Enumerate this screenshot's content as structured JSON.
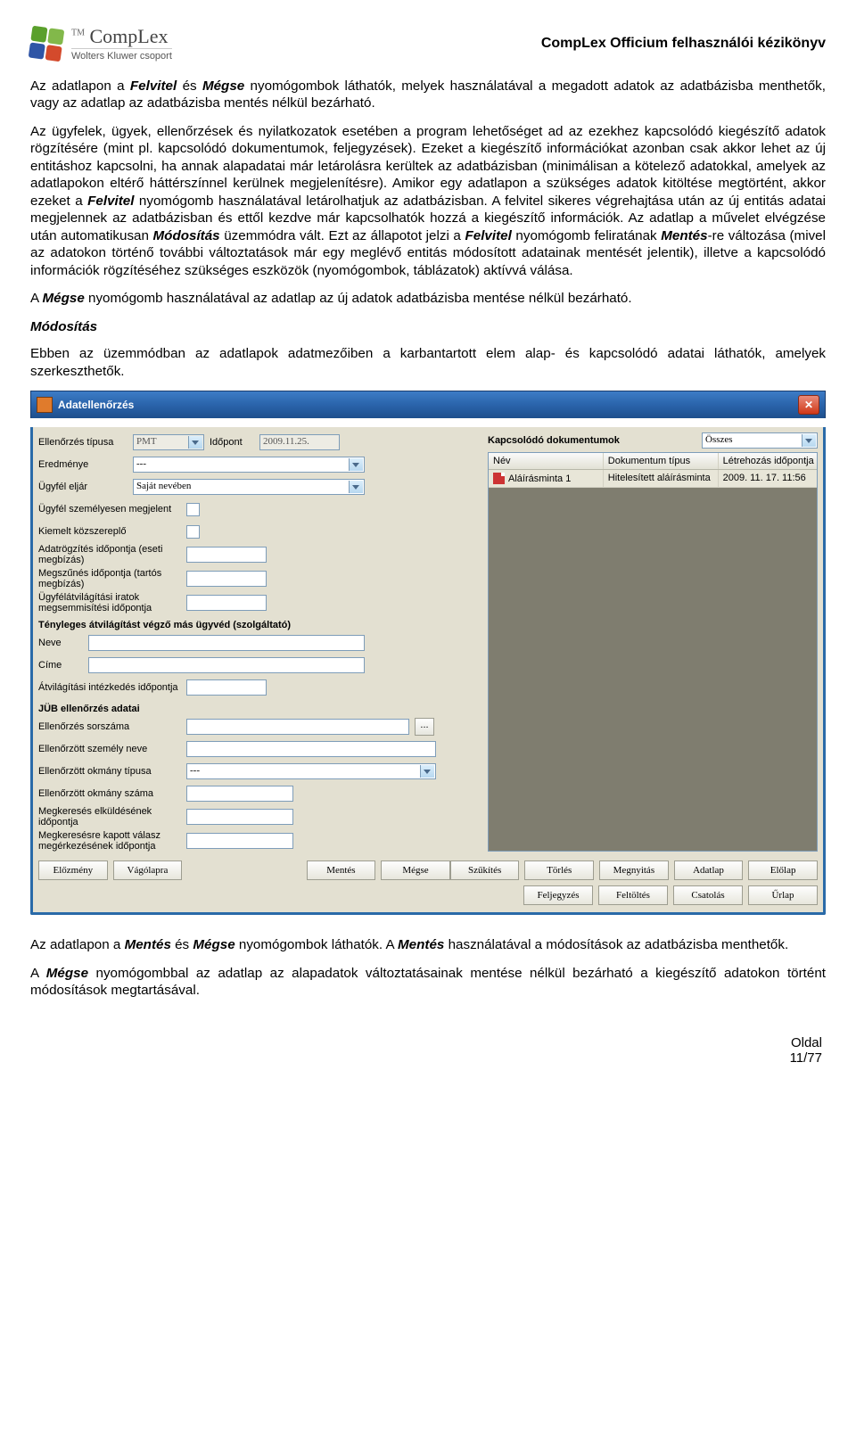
{
  "header": {
    "brand": "CompLex",
    "brand_prefix": "TM",
    "brand_sub": "Wolters Kluwer csoport",
    "doc_title": "CompLex Officium felhasználói kézikönyv"
  },
  "text": {
    "p1_a": "Az adatlapon a ",
    "p1_b": "Felvitel",
    "p1_c": " és ",
    "p1_d": "Mégse",
    "p1_e": " nyomógombok láthatók, melyek használatával a megadott adatok az adatbázisba menthetők, vagy az adatlap az adatbázisba mentés nélkül bezárható.",
    "p2_a": "Az ügyfelek, ügyek, ellenőrzések és nyilatkozatok esetében a program lehetőséget ad az ezekhez kapcsolódó kiegészítő adatok rögzítésére (mint pl. kapcsolódó dokumentumok, feljegyzések). Ezeket a kiegészítő információkat azonban csak akkor lehet az új entitáshoz kapcsolni, ha annak alapadatai már letárolásra kerültek az adatbázisban (minimálisan a kötelező adatokkal, amelyek az adatlapokon eltérő háttérszínnel kerülnek megjelenítésre). Amikor egy adatlapon a szükséges adatok kitöltése megtörtént, akkor ezeket a ",
    "p2_b": "Felvitel",
    "p2_c": " nyomógomb használatával letárolhatjuk az adatbázisban. A felvitel sikeres végrehajtása után az új entitás adatai megjelennek az adatbázisban és ettől kezdve már kapcsolhatók hozzá a kiegészítő információk. Az adatlap a művelet elvégzése után automatikusan ",
    "p2_d": "Módosítás",
    "p2_e": " üzemmódra vált. Ezt az állapotot jelzi a ",
    "p2_f": "Felvitel",
    "p2_g": " nyomógomb feliratának ",
    "p2_h": "Mentés",
    "p2_i": "-re változása (mivel az adatokon történő további változtatások már egy meglévő entitás módosított adatainak mentését jelentik), illetve a kapcsolódó információk rögzítéséhez szükséges eszközök (nyomógombok, táblázatok) aktívvá válása.",
    "p3_a": "A ",
    "p3_b": "Mégse",
    "p3_c": " nyomógomb használatával az adatlap az új adatok adatbázisba mentése nélkül bezárható.",
    "h_mod": "Módosítás",
    "p4": "Ebben az üzemmódban az adatlapok adatmezőiben a karbantartott elem alap- és kapcsolódó adatai láthatók, amelyek szerkeszthetők.",
    "p5_a": "Az adatlapon a ",
    "p5_b": "Mentés",
    "p5_c": " és ",
    "p5_d": "Mégse",
    "p5_e": " nyomógombok láthatók. A ",
    "p5_f": "Mentés",
    "p5_g": " használatával a módosítások az adatbázisba menthetők.",
    "p6_a": "A ",
    "p6_b": "Mégse",
    "p6_c": " nyomógombbal az adatlap az alapadatok változtatásainak mentése nélkül bezárható a kiegészítő adatokon történt módosítások megtartásával."
  },
  "dialog": {
    "title": "Adatellenőrzés",
    "labels": {
      "ell_tipus": "Ellenőrzés típusa",
      "idopont": "Időpont",
      "eredmenye": "Eredménye",
      "ugyfel_eljar": "Ügyfél eljár",
      "szemelyesen": "Ügyfél személyesen megjelent",
      "kiemelt": "Kiemelt közszereplő",
      "adatrogz": "Adatrögzítés időpontja (eseti megbízás)",
      "megszunes": "Megszűnés időpontja (tartós megbízás)",
      "megsemm": "Ügyfélátvilágítási iratok megsemmisítési időpontja",
      "section_tenyleges": "Tényleges átvilágítást végző más ügyvéd (szolgáltató)",
      "neve": "Neve",
      "cime": "Címe",
      "atvil_intez": "Átvilágítási intézkedés időpontja",
      "section_jub": "JÜB ellenőrzés adatai",
      "ell_sorszam": "Ellenőrzés sorszáma",
      "ell_szemely": "Ellenőrzött személy neve",
      "ell_okmany_t": "Ellenőrzött okmány típusa",
      "ell_okmany_sz": "Ellenőrzött okmány száma",
      "megkeres_elk": "Megkeresés elküldésének időpontja",
      "megkeres_kap": "Megkeresésre kapott válasz megérkezésének időpontja"
    },
    "values": {
      "ell_tipus": "PMT",
      "idopont": "2009.11.25.",
      "eredmenye": "---",
      "ugyfel_eljar": "Saját nevében",
      "ell_okmany_t": "---"
    },
    "right": {
      "kapcs": "Kapcsolódó dokumentumok",
      "filter": "Összes",
      "headers": {
        "nev": "Név",
        "tip": "Dokumentum típus",
        "letre": "Létrehozás időpontja"
      },
      "row": {
        "nev": "Aláírásminta 1",
        "tip": "Hitelesített aláírásminta",
        "letre": "2009. 11. 17. 11:56"
      }
    },
    "buttons": {
      "elozmeny": "Előzmény",
      "vagolap": "Vágólapra",
      "mentes": "Mentés",
      "megse": "Mégse",
      "szukites": "Szűkítés",
      "torles": "Törlés",
      "megnyitas": "Megnyitás",
      "adatlap": "Adatlap",
      "elolap": "Előlap",
      "feljegyzes": "Feljegyzés",
      "feltoltes": "Feltöltés",
      "csatolas": "Csatolás",
      "urlap": "Űrlap",
      "dots": "..."
    }
  },
  "footer": {
    "oldal": "Oldal",
    "page": "11/77"
  }
}
